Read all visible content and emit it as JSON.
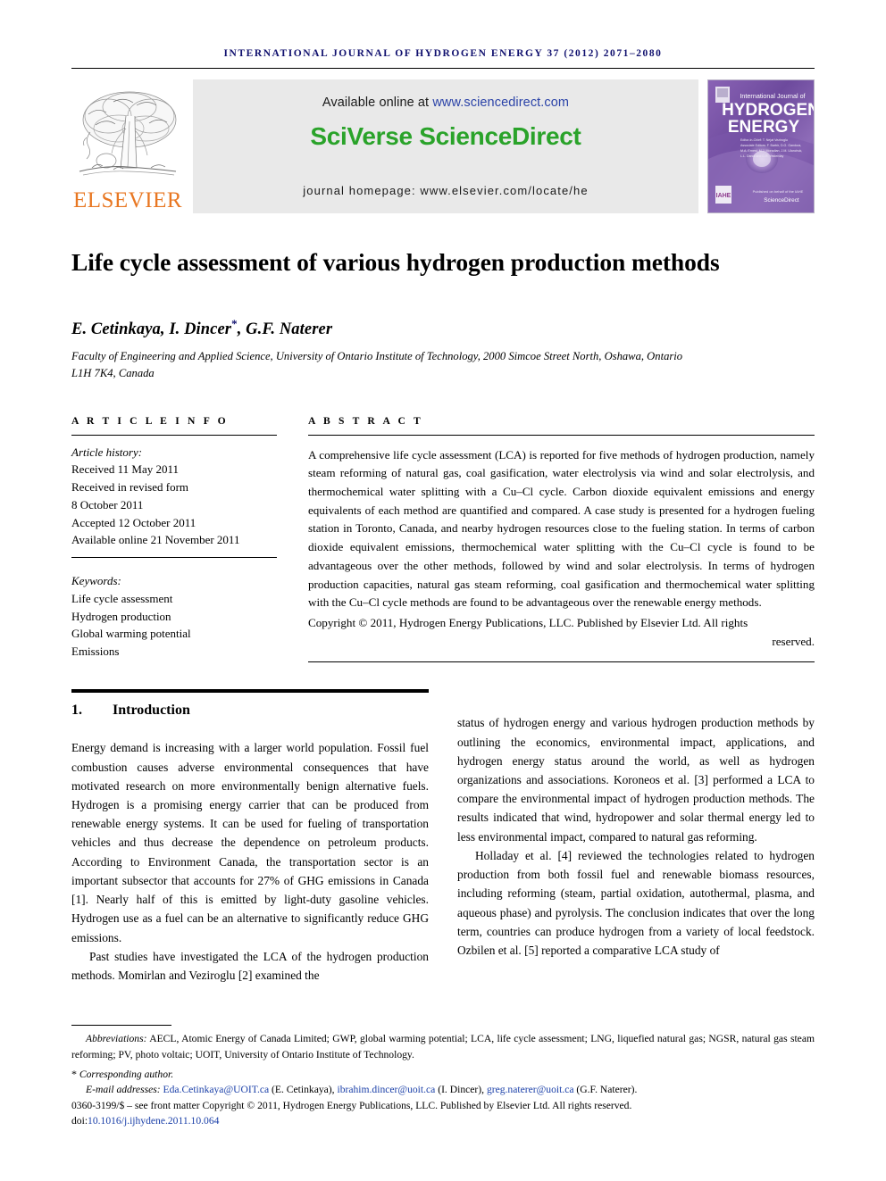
{
  "running_head": "INTERNATIONAL JOURNAL OF HYDROGEN ENERGY 37 (2012) 2071–2080",
  "masthead": {
    "publisher_name": "ELSEVIER",
    "available_prefix": "Available online at ",
    "available_url": "www.sciencedirect.com",
    "platform_title": "SciVerse ScienceDirect",
    "homepage_line": "journal homepage: www.elsevier.com/locate/he",
    "cover": {
      "line_small": "International Journal of",
      "line1": "HYDROGEN",
      "line2": "ENERGY",
      "editor_label": "Editor-in-Chief:",
      "editor_name": "T. Nejat Veziroglu",
      "assoc_label": "Associate Editors:",
      "assoc_names": "C. Barbir, D.G. Gandura, M.A. Ernest, M.J. Moradian, J.M. Ulanchuk, L.L. Dandi and D.R. Yesterday",
      "footer_brand": "ScienceDirect",
      "footer_small": "Published on behalf of the IAHE"
    }
  },
  "article": {
    "title": "Life cycle assessment of various hydrogen production methods",
    "authors": "E. Cetinkaya, I. Dincer",
    "author_star": "*",
    "authors_tail": ", G.F. Naterer",
    "affiliation": "Faculty of Engineering and Applied Science, University of Ontario Institute of Technology, 2000 Simcoe Street North, Oshawa, Ontario L1H 7K4, Canada"
  },
  "article_info": {
    "heading": "A R T I C L E   I N F O",
    "history_label": "Article history:",
    "history": [
      "Received 11 May 2011",
      "Received in revised form",
      "8 October 2011",
      "Accepted 12 October 2011",
      "Available online 21 November 2011"
    ],
    "keywords_label": "Keywords:",
    "keywords": [
      "Life cycle assessment",
      "Hydrogen production",
      "Global warming potential",
      "Emissions"
    ]
  },
  "abstract": {
    "heading": "A B S T R A C T",
    "body": "A comprehensive life cycle assessment (LCA) is reported for five methods of hydrogen production, namely steam reforming of natural gas, coal gasification, water electrolysis via wind and solar electrolysis, and thermochemical water splitting with a Cu–Cl cycle. Carbon dioxide equivalent emissions and energy equivalents of each method are quantified and compared. A case study is presented for a hydrogen fueling station in Toronto, Canada, and nearby hydrogen resources close to the fueling station. In terms of carbon dioxide equivalent emissions, thermochemical water splitting with the Cu–Cl cycle is found to be advantageous over the other methods, followed by wind and solar electrolysis. In terms of hydrogen production capacities, natural gas steam reforming, coal gasification and thermochemical water splitting with the Cu–Cl cycle methods are found to be advantageous over the renewable energy methods.",
    "copyright": "Copyright © 2011, Hydrogen Energy Publications, LLC. Published by Elsevier Ltd. All rights",
    "copyright_tail": "reserved."
  },
  "section": {
    "number": "1.",
    "name": "Introduction"
  },
  "body_text": {
    "left": [
      "Energy demand is increasing with a larger world population. Fossil fuel combustion causes adverse environmental consequences that have motivated research on more environmentally benign alternative fuels. Hydrogen is a promising energy carrier that can be produced from renewable energy systems. It can be used for fueling of transportation vehicles and thus decrease the dependence on petroleum products. According to Environment Canada, the transportation sector is an important subsector that accounts for 27% of GHG emissions in Canada [1]. Nearly half of this is emitted by light-duty gasoline vehicles. Hydrogen use as a fuel can be an alternative to significantly reduce GHG emissions.",
      "Past studies have investigated the LCA of the hydrogen production methods. Momirlan and Veziroglu [2] examined the"
    ],
    "right": [
      "status of hydrogen energy and various hydrogen production methods by outlining the economics, environmental impact, applications, and hydrogen energy status around the world, as well as hydrogen organizations and associations. Koroneos et al. [3] performed a LCA to compare the environmental impact of hydrogen production methods. The results indicated that wind, hydropower and solar thermal energy led to less environmental impact, compared to natural gas reforming.",
      "Holladay et al. [4] reviewed the technologies related to hydrogen production from both fossil fuel and renewable biomass resources, including reforming (steam, partial oxidation, autothermal, plasma, and aqueous phase) and pyrolysis. The conclusion indicates that over the long term, countries can produce hydrogen from a variety of local feedstock. Ozbilen et al. [5] reported a comparative LCA study of"
    ]
  },
  "footnotes": {
    "abbrev_label": "Abbreviations:",
    "abbrev_text": " AECL, Atomic Energy of Canada Limited; GWP, global warming potential; LCA, life cycle assessment; LNG, liquefied natural gas; NGSR, natural gas steam reforming; PV, photo voltaic; UOIT, University of Ontario Institute of Technology.",
    "corresponding": "Corresponding author.",
    "email_label": "E-mail addresses:",
    "emails": [
      {
        "addr": "Eda.Cetinkaya@UOIT.ca",
        "who": " (E. Cetinkaya), "
      },
      {
        "addr": "ibrahim.dincer@uoit.ca",
        "who": " (I. Dincer), "
      },
      {
        "addr": "greg.naterer@uoit.ca",
        "who": " (G.F. Naterer)."
      }
    ],
    "issn_line": "0360-3199/$ – see front matter Copyright © 2011, Hydrogen Energy Publications, LLC. Published by Elsevier Ltd. All rights reserved.",
    "doi_prefix": "doi:",
    "doi": "10.1016/j.ijhydene.2011.10.064"
  },
  "colors": {
    "running_head": "#10106e",
    "elsevier_orange": "#e87722",
    "sciencedirect_green": "#2aa32a",
    "link_blue": "#1a3fa8",
    "reference_blue": "#1a1a8c"
  }
}
